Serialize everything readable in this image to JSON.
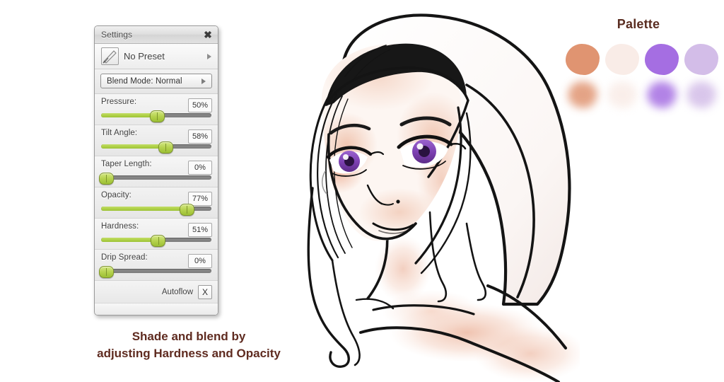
{
  "panel": {
    "title": "Settings",
    "close_icon": "close-icon",
    "close_glyph": "✖",
    "preset": {
      "label": "No Preset",
      "thumb_icon": "brush-stroke-thumbnail",
      "arrow_icon": "arrow-right-icon"
    },
    "blend_mode": {
      "label": "Blend Mode: Normal",
      "arrow_icon": "arrow-right-icon"
    },
    "sliders": [
      {
        "name": "pressure",
        "label": "Pressure:",
        "value": "50%",
        "percent": 50
      },
      {
        "name": "tilt-angle",
        "label": "Tilt Angle:",
        "value": "58%",
        "percent": 58
      },
      {
        "name": "taper-length",
        "label": "Taper Length:",
        "value": "0%",
        "percent": 4
      },
      {
        "name": "opacity",
        "label": "Opacity:",
        "value": "77%",
        "percent": 77
      },
      {
        "name": "hardness",
        "label": "Hardness:",
        "value": "51%",
        "percent": 51
      },
      {
        "name": "drip-spread",
        "label": "Drip Spread:",
        "value": "0%",
        "percent": 4
      }
    ],
    "autoflow": {
      "label": "Autoflow",
      "checkbox_value": "X"
    },
    "colors": {
      "slider_fill": "#aed046",
      "slider_track": "#808080",
      "panel_bg": "#eeeeee",
      "border": "#9a9a9a"
    }
  },
  "caption": {
    "line1": "Shade and blend by",
    "line2": "adjusting Hardness and Opacity",
    "color": "#5f2b20"
  },
  "palette": {
    "title": "Palette",
    "title_color": "#5a2d21",
    "swatches": [
      {
        "name": "swatch-salmon",
        "color": "#e09471",
        "soft_color": "#e09471"
      },
      {
        "name": "swatch-pale-pink",
        "color": "#f9ece7",
        "soft_color": "#f9ece7"
      },
      {
        "name": "swatch-purple",
        "color": "#a56ee2",
        "soft_color": "#a56ee2"
      },
      {
        "name": "swatch-lavender",
        "color": "#d3bde8",
        "soft_color": "#d3bde8"
      }
    ]
  },
  "artwork": {
    "name": "portrait-illustration",
    "description": "Anime-style female portrait with long white hair, purple eyes and soft peach shading",
    "line_color": "#111111",
    "skin_shadow": "#e8a98c",
    "skin_light": "#fbeee8",
    "eye_color": "#7b3fb0",
    "hair_color": "#ffffff"
  }
}
